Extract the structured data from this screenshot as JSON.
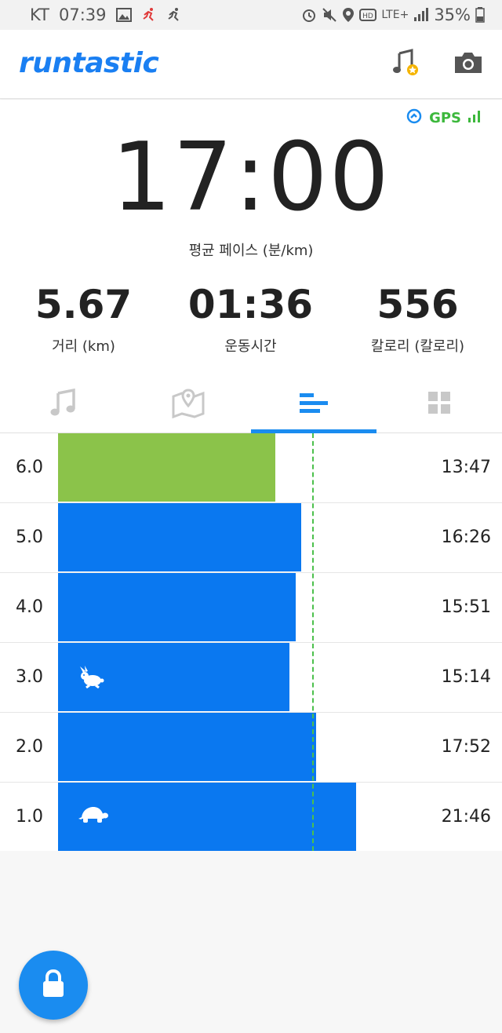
{
  "status_bar": {
    "carrier": "KT",
    "time": "07:39",
    "network": "LTE+",
    "battery": "35%"
  },
  "app": {
    "brand": "runtastic",
    "brand_color": "#1a7ff2",
    "header_icons": [
      "music-star-icon",
      "camera-icon"
    ]
  },
  "gps": {
    "label": "GPS",
    "color": "#3cb83c"
  },
  "main_stat": {
    "value": "17:00",
    "label": "평균 페이스 (분/km)"
  },
  "stats": [
    {
      "value": "5.67",
      "label": "거리 (km)"
    },
    {
      "value": "01:36",
      "label": "운동시간"
    },
    {
      "value": "556",
      "label": "칼로리 (칼로리)"
    }
  ],
  "tabs": [
    {
      "icon": "music-note-icon",
      "active": false
    },
    {
      "icon": "map-pin-icon",
      "active": false
    },
    {
      "icon": "splits-bars-icon",
      "active": true
    },
    {
      "icon": "grid-icon",
      "active": false
    }
  ],
  "splits": {
    "average_fraction": 0.572,
    "rows": [
      {
        "km": "6.0",
        "time": "13:47",
        "fraction": 0.489,
        "color": "#8bc34a",
        "icon": ""
      },
      {
        "km": "5.0",
        "time": "16:26",
        "fraction": 0.548,
        "color": "#0a78f0",
        "icon": ""
      },
      {
        "km": "4.0",
        "time": "15:51",
        "fraction": 0.535,
        "color": "#0a78f0",
        "icon": ""
      },
      {
        "km": "3.0",
        "time": "15:14",
        "fraction": 0.521,
        "color": "#0a78f0",
        "icon": "rabbit-icon"
      },
      {
        "km": "2.0",
        "time": "17:52",
        "fraction": 0.581,
        "color": "#0a78f0",
        "icon": ""
      },
      {
        "km": "1.0",
        "time": "21:46",
        "fraction": 0.672,
        "color": "#0a78f0",
        "icon": "turtle-icon"
      }
    ]
  },
  "fab": {
    "icon": "lock-icon"
  }
}
